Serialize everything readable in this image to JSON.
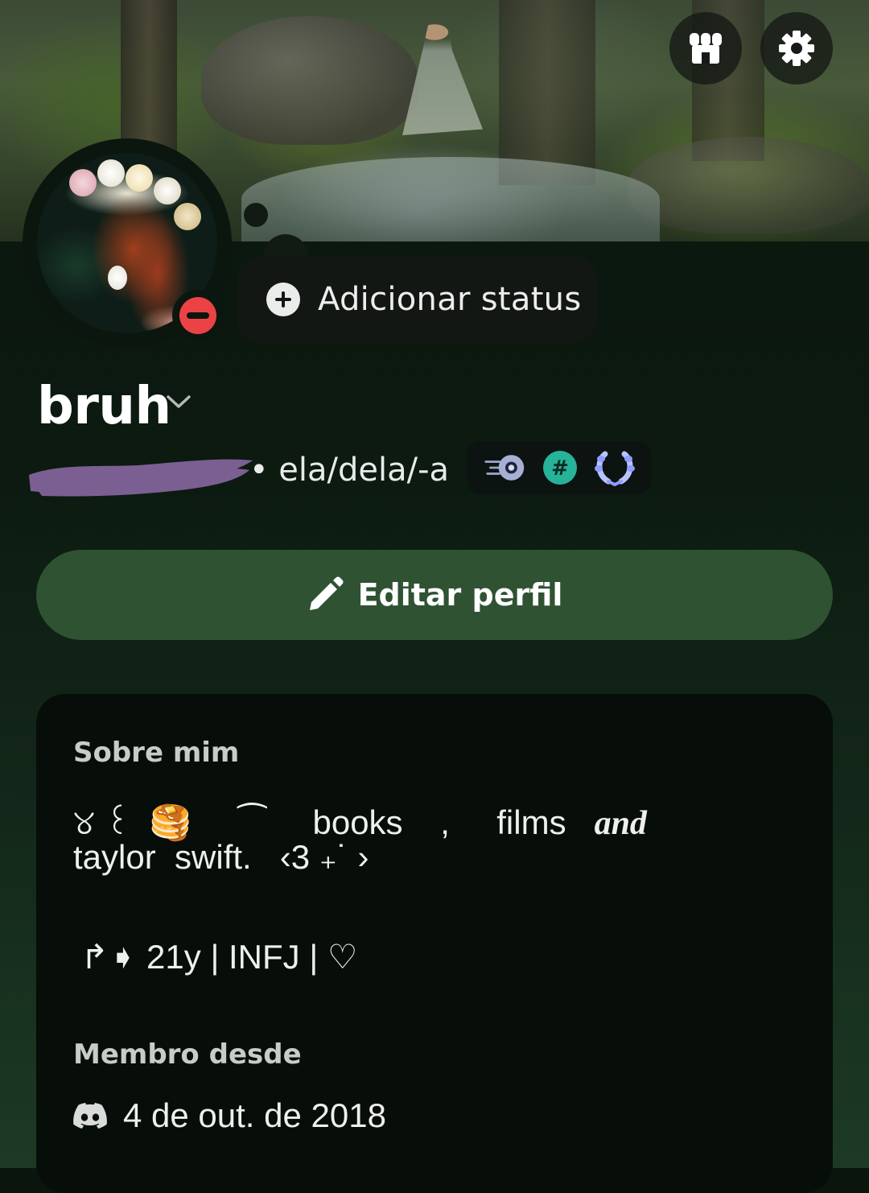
{
  "header": {
    "shop_icon": "shop-icon",
    "settings_icon": "gear-icon"
  },
  "status": {
    "add_label": "Adicionar status"
  },
  "profile": {
    "display_name": "bruh",
    "pronouns": "• ela/dela/-a",
    "badges": [
      "speed-badge-icon",
      "hashtag-badge-icon",
      "laurel-badge-icon"
    ],
    "status_color": "#ed4245"
  },
  "actions": {
    "edit_profile": "Editar perfil",
    "accent_color": "#2f5232"
  },
  "about": {
    "title": "Sobre mim",
    "line1_a": "୪ ꒰  🥞     ⁀     books    ,     films   ",
    "line1_and": "and",
    "line2": "taylor  swift.   ‹3 ₊˙ ›",
    "line3": "↱➧ 21y | INFJ | ♡"
  },
  "member": {
    "title": "Membro desde",
    "date": "4 de out. de 2018"
  }
}
